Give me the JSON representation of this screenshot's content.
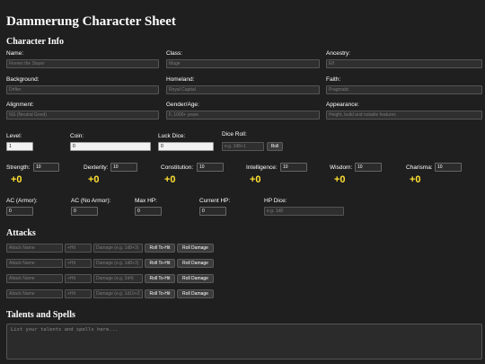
{
  "title": "Dammerung Character Sheet",
  "character_info": {
    "heading": "Character Info",
    "name": {
      "label": "Name:",
      "placeholder": "Fireren the Slayer"
    },
    "class": {
      "label": "Class:",
      "placeholder": "Mage"
    },
    "ancestry": {
      "label": "Ancestry:",
      "placeholder": "Elf"
    },
    "background": {
      "label": "Background:",
      "placeholder": "Drifter"
    },
    "homeland": {
      "label": "Homeland:",
      "placeholder": "Royal Capital"
    },
    "faith": {
      "label": "Faith:",
      "placeholder": "Pragmatic"
    },
    "alignment": {
      "label": "Alignment:",
      "placeholder": "NG (Neutral Good)"
    },
    "gender_age": {
      "label": "Gender/Age:",
      "placeholder": "F, 1000+ years"
    },
    "appearance": {
      "label": "Appearance:",
      "placeholder": "Height, build and notable features"
    }
  },
  "stats_row": {
    "level": {
      "label": "Level:",
      "value": "1"
    },
    "coin": {
      "label": "Coin:",
      "value": "0"
    },
    "luck_dice": {
      "label": "Luck Dice:",
      "value": "0"
    },
    "dice_roll": {
      "label": "Dice Roll:",
      "placeholder": "e.g. 2d8+1",
      "button": "Roll"
    }
  },
  "abilities": [
    {
      "label": "Strength:",
      "value": "10",
      "modifier": "+0"
    },
    {
      "label": "Dexterity:",
      "value": "10",
      "modifier": "+0"
    },
    {
      "label": "Constitution:",
      "value": "10",
      "modifier": "+0"
    },
    {
      "label": "Intelligence:",
      "value": "10",
      "modifier": "+0"
    },
    {
      "label": "Wisdom:",
      "value": "10",
      "modifier": "+0"
    },
    {
      "label": "Charisma:",
      "value": "10",
      "modifier": "+0"
    }
  ],
  "defense": {
    "ac_armor": {
      "label": "AC (Armor):",
      "value": "0"
    },
    "ac_no_armor": {
      "label": "AC (No Armor):",
      "value": "0"
    },
    "max_hp": {
      "label": "Max HP:",
      "value": "0"
    },
    "current_hp": {
      "label": "Current HP:",
      "value": "0"
    },
    "hp_dice": {
      "label": "HP Dice:",
      "placeholder": "e.g. 1d8"
    }
  },
  "attacks": {
    "heading": "Attacks",
    "rows": [
      {
        "name_placeholder": "Attack Name",
        "hit_placeholder": "+Hit",
        "damage_placeholder": "Damage (e.g. 1d8+3)",
        "roll_hit": "Roll To-Hit",
        "roll_damage": "Roll Damage"
      },
      {
        "name_placeholder": "Attack Name",
        "hit_placeholder": "+Hit",
        "damage_placeholder": "Damage (e.g. 1d8+3)",
        "roll_hit": "Roll To-Hit",
        "roll_damage": "Roll Damage"
      },
      {
        "name_placeholder": "Attack Name",
        "hit_placeholder": "+Hit",
        "damage_placeholder": "Damage (e.g. 2d4)",
        "roll_hit": "Roll To-Hit",
        "roll_damage": "Roll Damage"
      },
      {
        "name_placeholder": "Attack Name",
        "hit_placeholder": "+Hit",
        "damage_placeholder": "Damage (e.g. 1d10+2)",
        "roll_hit": "Roll To-Hit",
        "roll_damage": "Roll Damage"
      }
    ]
  },
  "talents": {
    "heading": "Talents and Spells",
    "placeholder": "List your talents and spells here..."
  },
  "colors": {
    "background": "#1f1f1f",
    "modifier": "#ffe033"
  }
}
